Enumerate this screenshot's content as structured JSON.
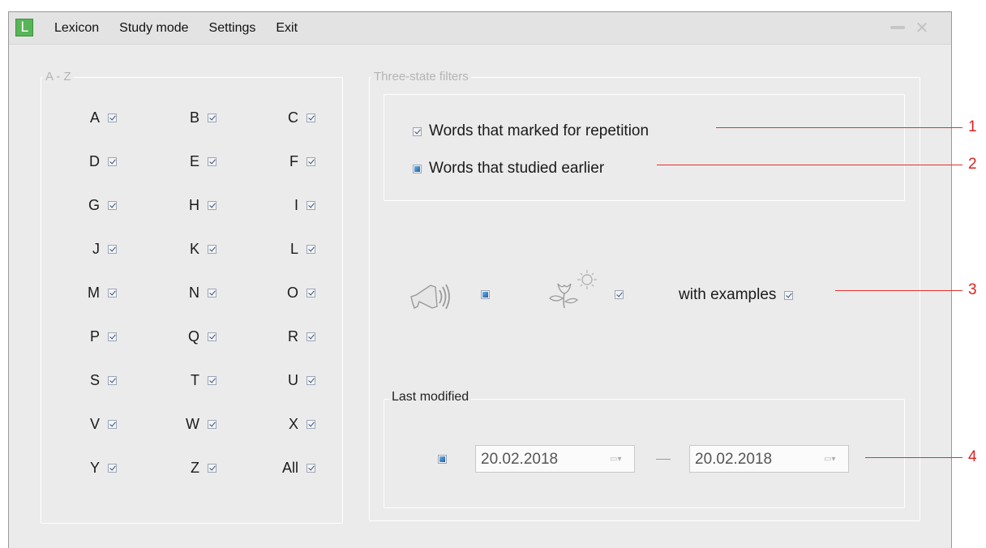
{
  "app": {
    "logo_letter": "L"
  },
  "menu": [
    "Lexicon",
    "Study mode",
    "Settings",
    "Exit"
  ],
  "window_controls": {
    "minimize_icon": "minimize-icon",
    "close_icon": "close-icon",
    "close_glyph": "✕"
  },
  "az_group": {
    "title": "A - Z",
    "letters": [
      "A",
      "B",
      "C",
      "D",
      "E",
      "F",
      "G",
      "H",
      "I",
      "J",
      "K",
      "L",
      "M",
      "N",
      "O",
      "P",
      "Q",
      "R",
      "S",
      "T",
      "U",
      "V",
      "W",
      "X",
      "Y",
      "Z",
      "All"
    ]
  },
  "filters_group": {
    "title": "Three-state filters",
    "marked_label": "Words that marked for repetition",
    "studied_label": "Words that studied earlier",
    "with_examples_label": "with examples",
    "sound_icon": "megaphone-icon",
    "flower_icon": "flower-icon"
  },
  "last_modified": {
    "title": "Last modified",
    "from": "20.02.2018",
    "to": "20.02.2018"
  },
  "annotations": [
    "1",
    "2",
    "3",
    "4"
  ],
  "colors": {
    "annotation": "#e02020",
    "accent_check": "#1d5e9e",
    "logo": "#57b557"
  }
}
